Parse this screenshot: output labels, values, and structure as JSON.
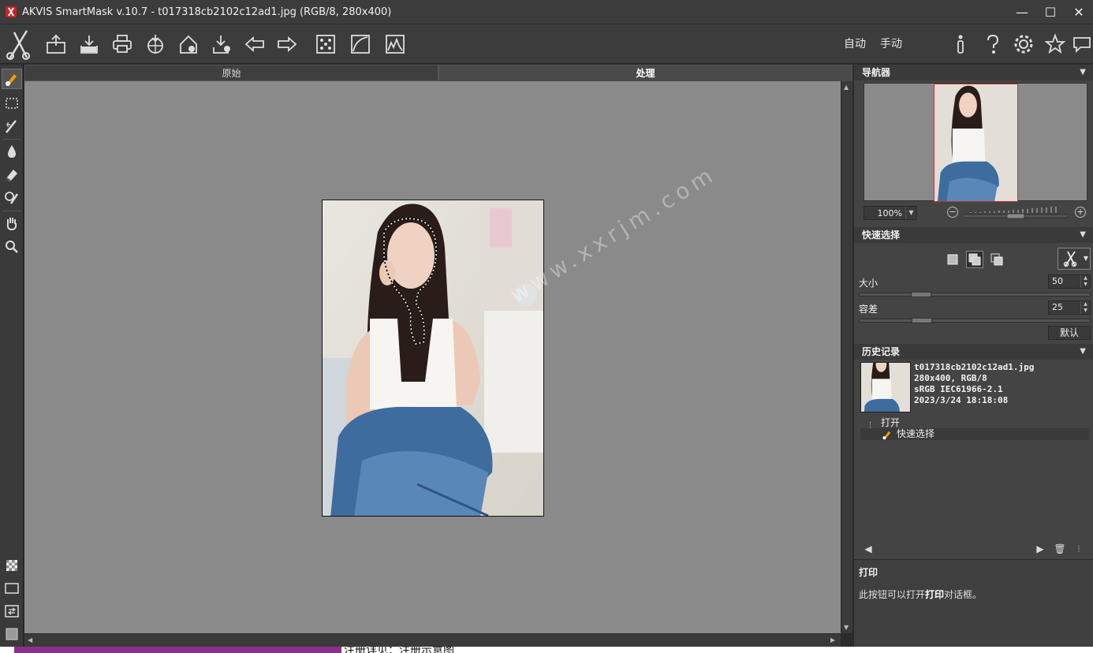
{
  "window": {
    "title": "AKVIS SmartMask v.10.7 - t017318cb2102c12ad1.jpg (RGB/8, 280x400)",
    "minimize": "—",
    "maximize": "☐",
    "close": "✕"
  },
  "toolbar": {
    "buttons": [
      "open-icon",
      "save-icon",
      "print-icon",
      "share-icon",
      "export-icon",
      "batch-icon",
      "plugin-icon",
      "undo-arrow-icon",
      "redo-arrow-icon",
      "mask-icon",
      "curve-icon",
      "histogram-icon"
    ],
    "mode_auto": "自动",
    "mode_manual": "手动",
    "right_icons": [
      "info-icon",
      "help-icon",
      "settings-icon",
      "favorites-icon",
      "chat-icon"
    ]
  },
  "tools": [
    "quick-selection-icon",
    "rect-selection-icon",
    "magic-brush-icon",
    "drop-icon",
    "eraser-icon",
    "brush-tool-icon",
    "hand-icon",
    "zoom-icon"
  ],
  "tabs": {
    "original": "原始",
    "processing": "处理"
  },
  "watermark": "www.xxrjm.com",
  "footer_text": "注册详见：注册示意图",
  "navigator": {
    "title": "导航器",
    "zoom": "100%"
  },
  "quick_select": {
    "title": "快速选择",
    "size_label": "大小",
    "size_value": "50",
    "tolerance_label": "容差",
    "tolerance_value": "25",
    "default_button": "默认"
  },
  "history": {
    "title": "历史记录",
    "file_name": "t017318cb2102c12ad1.jpg",
    "dims": "280x400, RGB/8",
    "profile": "sRGB IEC61966-2.1",
    "date": "2023/3/24 18:18:08",
    "items": [
      "打开",
      "快速选择"
    ]
  },
  "help": {
    "title": "打印",
    "text_before": "此按钮可以打开",
    "text_bold": "打印",
    "text_after": "对话框。"
  },
  "colors": {
    "canvas": "#8a8a8a",
    "panel": "#444444",
    "navigator_frame": "#d03030",
    "accent_tool": "#f2a100"
  }
}
